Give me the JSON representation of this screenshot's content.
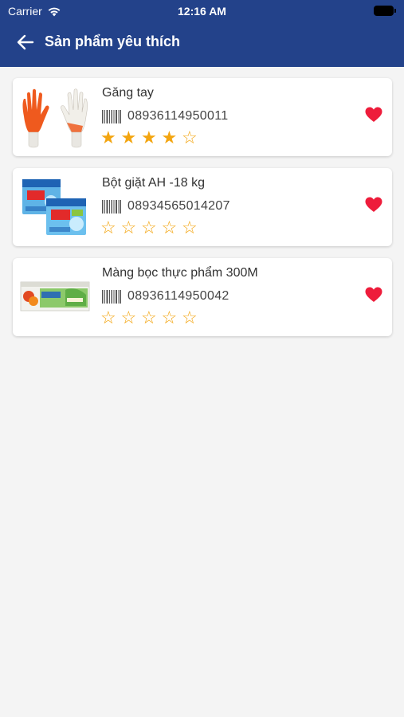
{
  "status_bar": {
    "carrier": "Carrier",
    "time": "12:16 AM"
  },
  "header": {
    "title": "Sản phẩm yêu thích",
    "back_icon": "arrow-left-icon"
  },
  "colors": {
    "header_bg": "#23428a",
    "star": "#f3a510",
    "heart": "#ee1c3b",
    "page_bg": "#f4f4f4"
  },
  "products": [
    {
      "name": "Găng tay",
      "barcode": "08936114950011",
      "rating": 4,
      "max_rating": 5,
      "favorite": true,
      "image": "orange-gloves"
    },
    {
      "name": "Bột giặt AH -18 kg",
      "barcode": "08934565014207",
      "rating": 0,
      "max_rating": 5,
      "favorite": true,
      "image": "detergent-boxes"
    },
    {
      "name": "Màng bọc thực phẩm 300M",
      "barcode": "08936114950042",
      "rating": 0,
      "max_rating": 5,
      "favorite": true,
      "image": "food-wrap-box"
    }
  ]
}
